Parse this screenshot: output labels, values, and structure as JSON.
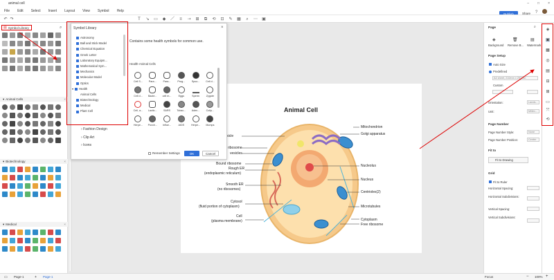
{
  "window": {
    "title": "animal cell"
  },
  "menu": [
    "File",
    "Edit",
    "Select",
    "Insert",
    "Layout",
    "View",
    "Symbol",
    "Help"
  ],
  "topright": {
    "publish": "Publish",
    "share": "Share"
  },
  "library": {
    "header": "Symbol Library",
    "sections": [
      "Animal Cells",
      "Biotechnology",
      "Medical"
    ]
  },
  "dialog": {
    "title": "Symbol Library",
    "tree": [
      "Astronomy",
      "Ball and Stick Model",
      "Chemical Equation",
      "Greek Letter",
      "Laboratory Equipm...",
      "Mathematical Sym...",
      "Mechanics",
      "Molecular Model",
      "Optics"
    ],
    "health_parent": "Health",
    "health_children": [
      "Animal Cells",
      "Biotechnology",
      "Medical",
      "Plant Cell"
    ],
    "tree_more": [
      "Fashion Design",
      "Clip Art",
      "Icons"
    ],
    "description": "Contains some health symbols for common use.",
    "cells_title": "Health-Animal Cells",
    "cells": [
      "Cell S...",
      "Para...",
      "Para...",
      "Prog...",
      "Spuo...",
      "Cell d...",
      "Cell d...",
      "Bacte...",
      "cell m...",
      "Eggs",
      "Sperm",
      "Zygote",
      "Cell, a...",
      "Lactic...",
      "SARS",
      "Tobac...",
      "Aden...",
      "Colip...",
      "Herpe...",
      "Poxvir...",
      "Influe...",
      "AIDS",
      "Herpe...",
      "Mumps"
    ],
    "remember": "Remember Settings",
    "ok": "OK",
    "cancel": "Cancel"
  },
  "diagram": {
    "title": "Animal Cell",
    "left_labels": [
      "c vesicle",
      "ribosome",
      "vesicles",
      "Bound ribosome",
      "Rough ER",
      "(endoplasmic reticulum)",
      "Smooth ER",
      "(no ribosomes)",
      "Cytosol",
      "(fluid portion of cytoplasm)",
      "Cell",
      "(plasma membrane)"
    ],
    "right_labels": [
      "Mitochondrion",
      "Golgi apparatus",
      "Nucleolus",
      "Nucleus",
      "Centrioles(2)",
      "Microtubules",
      "Cytoplasm",
      "Free ribosome"
    ]
  },
  "rightpanel": {
    "page": "Page",
    "bg_buttons": [
      "Background",
      "Remove B...",
      "Watermark"
    ],
    "page_setup": "Page Setup",
    "auto_size": "Auto Size",
    "predefined": "Predefined",
    "paper": "A4 sheet, 210mm x 297mm",
    "custom": "Custom",
    "orientation_label": "Orientation:",
    "orientation_value": "Lands...",
    "unit_label": "Unit:",
    "unit_value": "Millim...",
    "page_number": "Page Number",
    "pn_style_label": "Page Number Style:",
    "pn_style_value": "None",
    "pn_pos_label": "Page Number Position:",
    "pn_pos_value": "Center",
    "fit_to": "Fit to",
    "fit_drawing": "Fit to Drawing",
    "grid": "Grid",
    "fit_ruler": "Fit to Ruler",
    "h_spacing": "Horizontal Spacing:",
    "h_sub": "Horizontal Subdivisions:",
    "v_spacing": "Vertical Spacing:",
    "v_sub": "Vertical Subdivisions:"
  },
  "status": {
    "page_tab": "Page-1",
    "page_tab2": "Page-1",
    "focus": "Focus",
    "zoom": "100%"
  }
}
